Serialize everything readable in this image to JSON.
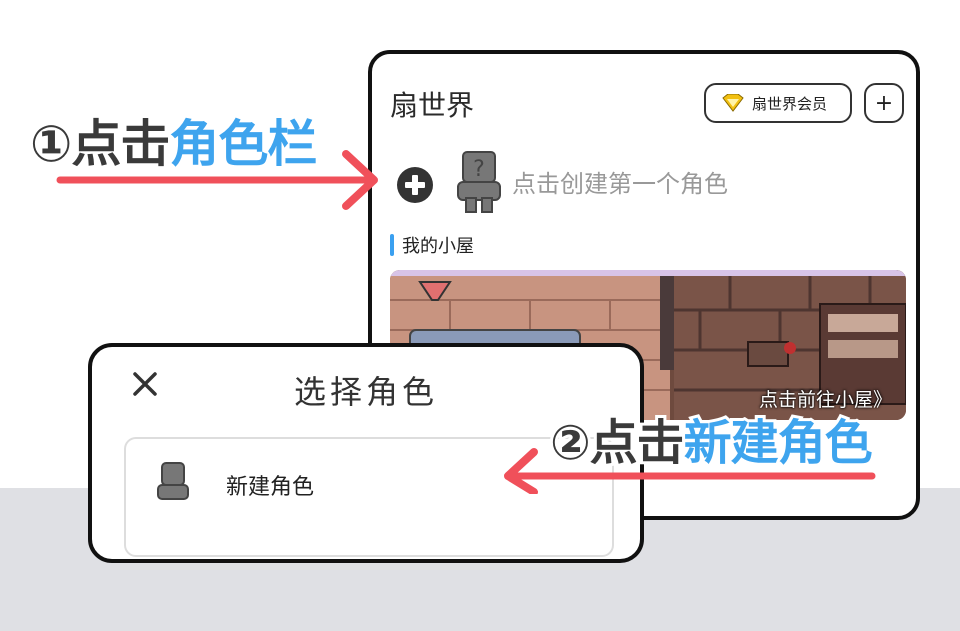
{
  "annotation1": {
    "num": "①",
    "action": "点击",
    "target": "角色栏"
  },
  "annotation2": {
    "num": "②",
    "action": "点击",
    "target": "新建角色"
  },
  "colors": {
    "accent_blue": "#3ea4ee",
    "arrow_red": "#f0505a",
    "dark_text": "#3a3a3a",
    "vip_gold": "#f2c010"
  },
  "world_screen": {
    "title": "扇世界",
    "vip_button": "扇世界会员",
    "plus_button": "+",
    "character_hint": "点击创建第一个角色",
    "section_title": "我的小屋",
    "house_link": "点击前往小屋》",
    "icons": [
      "plus-circle-icon",
      "placeholder-avatar-icon",
      "vip-gem-icon"
    ]
  },
  "select_sheet": {
    "title": "选择角色",
    "close_label": "×",
    "new_character_label": "新建角色",
    "icons": [
      "close-icon",
      "placeholder-avatar-icon"
    ]
  }
}
